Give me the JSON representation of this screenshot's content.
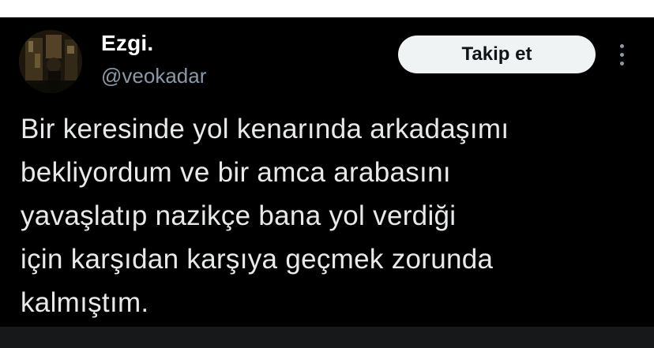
{
  "tweet": {
    "author": {
      "display_name": "Ezgi.",
      "handle": "@veokadar",
      "avatar_icon": "profile-photo"
    },
    "follow_button_label": "Takip et",
    "more_icon": "more-vertical-icon",
    "text": "Bir keresinde yol kenarında arkadaşımı\nbekliyordum ve bir amca arabasını\nyavaşlatıp nazikçe bana yol verdiği\niçin karşıdan karşıya geçmek zorunda\nkalmıştım."
  },
  "colors": {
    "background": "#000000",
    "text_primary": "#e7e9ea",
    "text_secondary": "#8b98a5",
    "button_bg": "#eff3f4",
    "button_text": "#0f1419"
  }
}
